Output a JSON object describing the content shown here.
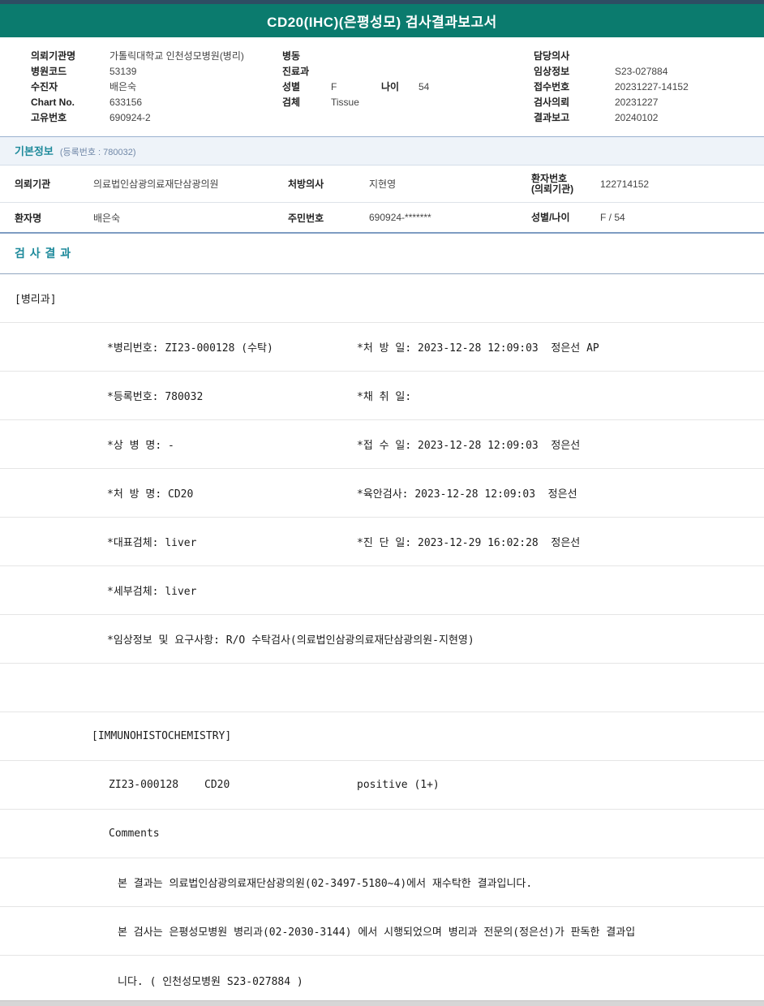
{
  "colors": {
    "title_bar_teal": "#0b7b6e",
    "top_strip_navy": "#2e4d63",
    "section_title_teal": "#1e8a9b",
    "accent_border_blue": "#8fa8c8"
  },
  "title_bar": {
    "title": "CD20(IHC)(은평성모) 검사결과보고서"
  },
  "patient_header": {
    "left": [
      {
        "label": "의뢰기관명",
        "value": "가톨릭대학교 인천성모병원(병리)"
      },
      {
        "label": "병원코드",
        "value": "53139"
      },
      {
        "label": "수진자",
        "value": "배은숙"
      },
      {
        "label": "Chart No.",
        "value": "633156"
      },
      {
        "label": "고유번호",
        "value": "690924-2"
      }
    ],
    "middle": {
      "ward_label": "병동",
      "ward_value": "",
      "dept_label": "진료과",
      "dept_value": "",
      "sex_label": "성별",
      "sex_value": "F",
      "age_label": "나이",
      "age_value": "54",
      "specimen_label": "검체",
      "specimen_value": "Tissue"
    },
    "right": [
      {
        "label": "담당의사",
        "value": ""
      },
      {
        "label": "임상정보",
        "value": "S23-027884"
      },
      {
        "label": "접수번호",
        "value": "20231227-14152"
      },
      {
        "label": "검사의뢰",
        "value": "20231227"
      },
      {
        "label": "결과보고",
        "value": "20240102"
      }
    ]
  },
  "basic_info": {
    "section_title": "기본정보",
    "section_subtitle": "(등록번호 : 780032)",
    "row1": {
      "c1_label": "의뢰기관",
      "c1_value": "의료법인삼광의료재단삼광의원",
      "c2_label": "처방의사",
      "c2_value": "지현영",
      "c3_label_line1": "환자번호",
      "c3_label_line2": "(의뢰기관)",
      "c3_value": "122714152"
    },
    "row2": {
      "c1_label": "환자명",
      "c1_value": "배은숙",
      "c2_label": "주민번호",
      "c2_value": "690924-*******",
      "c3_label": "성별/나이",
      "c3_value": "F / 54"
    }
  },
  "results": {
    "section_title": "검 사 결 과",
    "department": "[병리과]",
    "detail_rows": [
      {
        "left": "*병리번호: ZI23-000128 (수탁)",
        "right": "*처 방 일: 2023-12-28 12:09:03  정은선 AP"
      },
      {
        "left": "*등록번호: 780032",
        "right": "*채 취 일:"
      },
      {
        "left": "*상 병 명: -",
        "right": "*접 수 일: 2023-12-28 12:09:03  정은선"
      },
      {
        "left": "*처 방 명: CD20",
        "right": "*육안검사: 2023-12-28 12:09:03  정은선"
      },
      {
        "left": "*대표검체: liver",
        "right": "*진 단 일: 2023-12-29 16:02:28  정은선"
      },
      {
        "left": "*세부검체: liver",
        "right": ""
      },
      {
        "left": "*임상정보 및 요구사항: R/O 수탁검사(의료법인삼광의료재단삼광의원-지현영)",
        "right": ""
      }
    ],
    "ihc_header": "[IMMUNOHISTOCHEMISTRY]",
    "ihc_result": {
      "specimen_no": "ZI23-000128",
      "test_name": "CD20",
      "result_value": "positive (1+)"
    },
    "comments_label": "Comments",
    "comment_lines": [
      "본 결과는 의료법인삼광의료재단삼광의원(02-3497-5180~4)에서 재수탁한 결과입니다.",
      "본 검사는 은평성모병원 병리과(02-2030-3144) 에서 시행되었으며 병리과 전문의(정은선)가 판독한 결과입",
      "니다. ( 인천성모병원 S23-027884 )"
    ]
  }
}
